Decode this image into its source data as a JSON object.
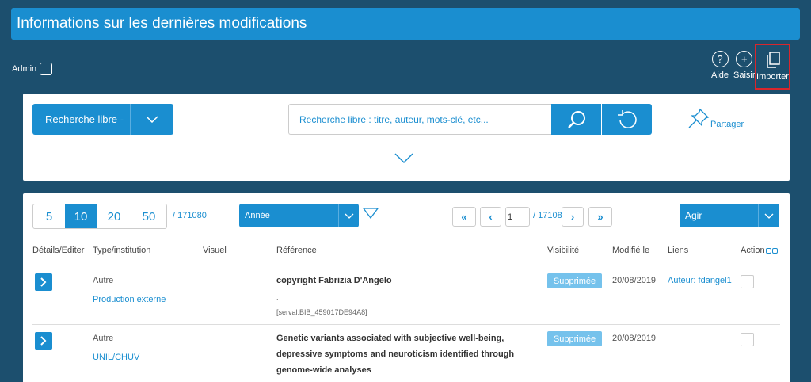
{
  "header": {
    "title": "Informations sur les dernières modifications"
  },
  "admin": {
    "label": "Admin"
  },
  "tools": {
    "aide": "Aide",
    "saisir": "Saisir",
    "importer": "Importer"
  },
  "search": {
    "mode_label": "- Recherche libre -",
    "placeholder": "Recherche libre : titre, auteur, mots-clé, etc...",
    "share_label": "Partager"
  },
  "results": {
    "page_sizes": [
      "5",
      "10",
      "20",
      "50"
    ],
    "active_page_size": "10",
    "total": "/ 171080",
    "sort_label": "Année",
    "current_page": "1",
    "page_count": "/ 17108",
    "action_label": "Agir",
    "columns": {
      "details": "Détails/Editer",
      "type": "Type/institution",
      "visuel": "Visuel",
      "reference": "Référence",
      "visibilite": "Visibilité",
      "modifie": "Modifié le",
      "liens": "Liens",
      "action": "Action"
    },
    "rows": [
      {
        "type": "Autre",
        "institution": "Production externe",
        "title": "copyright Fabrizia D'Angelo",
        "dot": ".",
        "serval": "[serval:BIB_459017DE94A8]",
        "visibility": "Supprimée",
        "modified": "20/08/2019",
        "link": "Auteur: fdangel1"
      },
      {
        "type": "Autre",
        "institution": "UNIL/CHUV",
        "title": "Genetic variants associated with subjective well-being, depressive symptoms and neuroticism identified through genome-wide analyses",
        "visibility": "Supprimée",
        "modified": "20/08/2019",
        "link": ""
      }
    ]
  }
}
